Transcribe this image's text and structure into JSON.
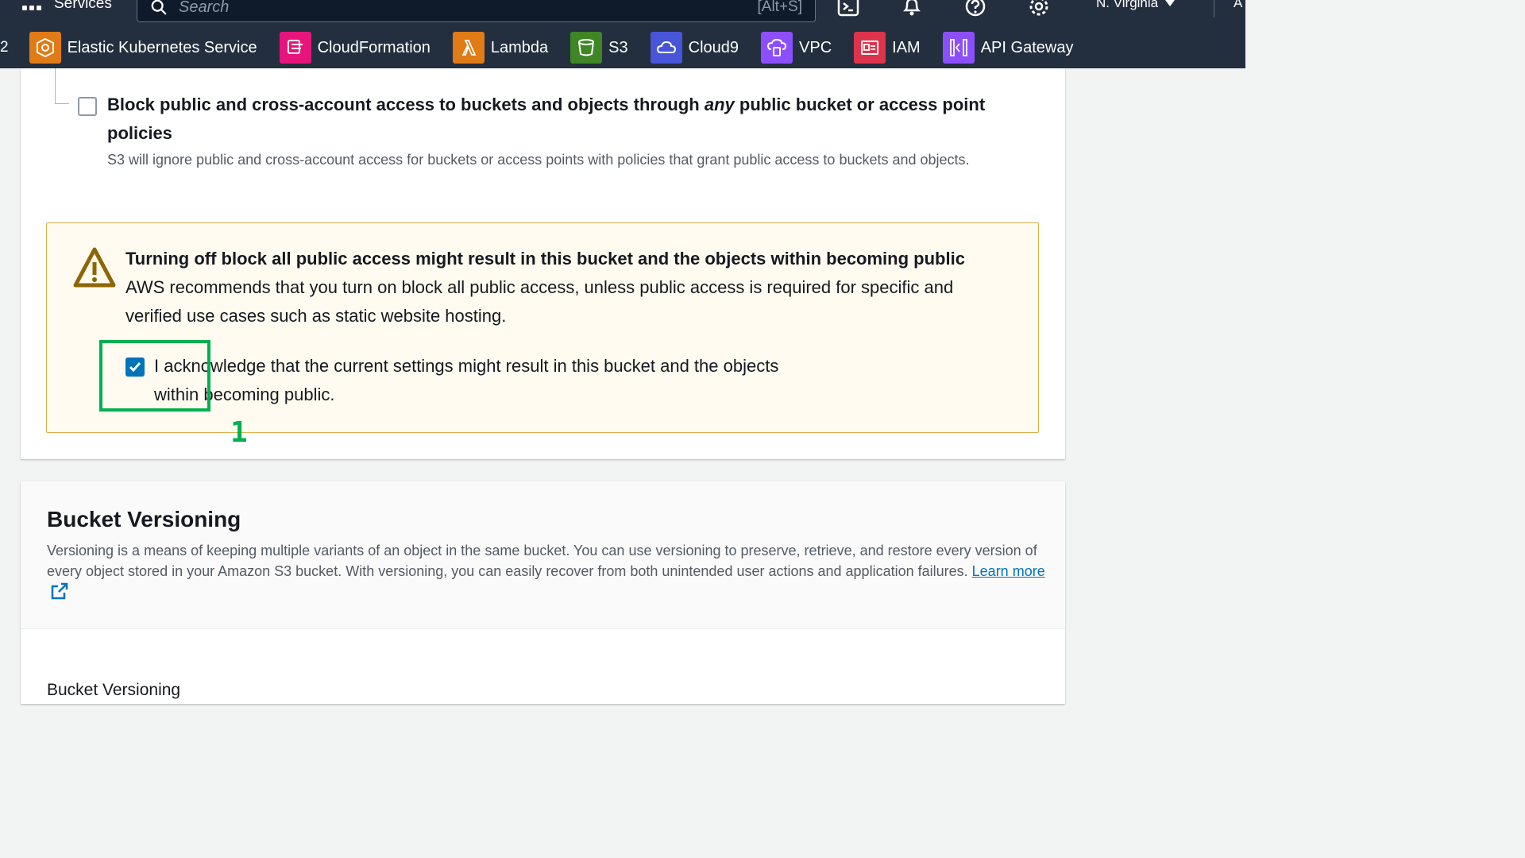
{
  "topbar": {
    "services_label": "Services",
    "search_placeholder": "Search",
    "search_shortcut": "[Alt+S]",
    "region": "N. Virginia",
    "account_cut": "A"
  },
  "favorites": {
    "cut_label": "2",
    "items": [
      {
        "label": "Elastic Kubernetes Service",
        "color": "#e07b16",
        "icon": "eks-icon"
      },
      {
        "label": "CloudFormation",
        "color": "#e7157b",
        "icon": "cloudformation-icon"
      },
      {
        "label": "Lambda",
        "color": "#e07b16",
        "icon": "lambda-icon"
      },
      {
        "label": "S3",
        "color": "#3f8624",
        "icon": "s3-icon"
      },
      {
        "label": "Cloud9",
        "color": "#4755d8",
        "icon": "cloud9-icon"
      },
      {
        "label": "VPC",
        "color": "#8c4fff",
        "icon": "vpc-icon"
      },
      {
        "label": "IAM",
        "color": "#dd344c",
        "icon": "iam-icon"
      },
      {
        "label": "API Gateway",
        "color": "#8c4fff",
        "icon": "api-gateway-icon"
      }
    ]
  },
  "block_option": {
    "title_prefix": "Block public and cross-account access to buckets and objects through ",
    "title_em": "any",
    "title_suffix": " public bucket or access point policies",
    "description": "S3 will ignore public and cross-account access for buckets or access points with policies that grant public access to buckets and objects.",
    "checked": false
  },
  "warning": {
    "title": "Turning off block all public access might result in this bucket and the objects within becoming public",
    "body": "AWS recommends that you turn on block all public access, unless public access is required for specific and verified use cases such as static website hosting.",
    "ack_text": "I acknowledge that the current settings might result in this bucket and the objects within becoming public.",
    "ack_checked": true
  },
  "annotation": {
    "number": "1",
    "color": "#00b050"
  },
  "versioning": {
    "title": "Bucket Versioning",
    "description": "Versioning is a means of keeping multiple variants of an object in the same bucket. You can use versioning to preserve, retrieve, and restore every version of every object stored in your Amazon S3 bucket. With versioning, you can easily recover from both unintended user actions and application failures.",
    "learn_more": "Learn more",
    "field_label": "Bucket Versioning"
  }
}
